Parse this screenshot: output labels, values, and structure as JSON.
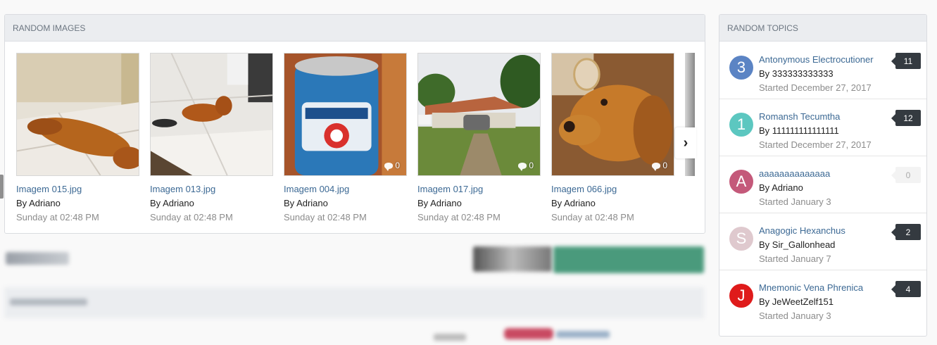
{
  "random_images": {
    "header": "Random Images",
    "items": [
      {
        "title": "Imagem 015.jpg",
        "by": "By Adriano",
        "date": "Sunday at 02:48 PM",
        "comments": ""
      },
      {
        "title": "Imagem 013.jpg",
        "by": "By Adriano",
        "date": "Sunday at 02:48 PM",
        "comments": ""
      },
      {
        "title": "Imagem 004.jpg",
        "by": "By Adriano",
        "date": "Sunday at 02:48 PM",
        "comments": "0"
      },
      {
        "title": "Imagem 017.jpg",
        "by": "By Adriano",
        "date": "Sunday at 02:48 PM",
        "comments": "0"
      },
      {
        "title": "Imagem 066.jpg",
        "by": "By Adriano",
        "date": "Sunday at 02:48 PM",
        "comments": "0"
      }
    ],
    "next_icon": "chevron-right-icon",
    "comment_icon": "comment-icon"
  },
  "random_topics": {
    "header": "Random Topics",
    "items": [
      {
        "avatar_letter": "3",
        "avatar_color": "#5b84c4",
        "title": "Antonymous Electrocutioner",
        "by": "By 333333333333",
        "date": "Started December 27, 2017",
        "count": "11"
      },
      {
        "avatar_letter": "1",
        "avatar_color": "#5cc7c0",
        "title": "Romansh Tecumtha",
        "by": "By 111111111111111",
        "date": "Started December 27, 2017",
        "count": "12"
      },
      {
        "avatar_letter": "A",
        "avatar_color": "#c4597a",
        "title": "aaaaaaaaaaaaaa",
        "by": "By Adriano",
        "date": "Started January 3",
        "count": "0"
      },
      {
        "avatar_letter": "S",
        "avatar_color": "#dfc9ce",
        "title": "Anagogic Hexanchus",
        "by": "By Sir_Gallonhead",
        "date": "Started January 7",
        "count": "2"
      },
      {
        "avatar_letter": "J",
        "avatar_color": "#df1b1b",
        "title": "Mnemonic Vena Phrenica",
        "by": "By JeWeetZelf151",
        "date": "Started January 3",
        "count": "4"
      }
    ]
  }
}
